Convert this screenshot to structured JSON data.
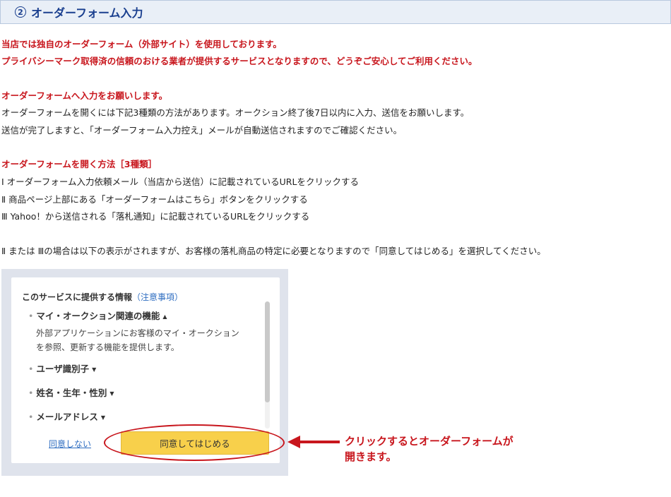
{
  "header": {
    "number": "2",
    "title": "オーダーフォーム入力"
  },
  "intro": {
    "line1": "当店では独自のオーダーフォーム（外部サイト）を使用しております。",
    "line2": "プライバシーマーク取得済の信頼のおける業者が提供するサービスとなりますので、どうぞご安心してご利用ください。"
  },
  "section1": {
    "heading": "オーダーフォームへ入力をお願いします。",
    "line1": "オーダーフォームを開くには下記3種類の方法があります。オークション終了後7日以内に入力、送信をお願いします。",
    "line2": "送信が完了しますと、「オーダーフォーム入力控え」メールが自動送信されますのでご確認ください。"
  },
  "section2": {
    "heading": "オーダーフォームを開く方法［3種類］",
    "methods": [
      "Ⅰ  オーダーフォーム入力依頼メール（当店から送信）に記載されているURLをクリックする",
      "Ⅱ  商品ページ上部にある「オーダーフォームはこちら」ボタンをクリックする",
      "Ⅲ  Yahoo！から送信される「落札通知」に記載されているURLをクリックする"
    ],
    "note": "Ⅱ または Ⅲの場合は以下の表示がされますが、お客様の落札商品の特定に必要となりますので「同意してはじめる」を選択してください。"
  },
  "consent": {
    "info_title": "このサービスに提供する情報",
    "info_link": "（注意事項）",
    "items": [
      {
        "label": "マイ・オークション関連の機能",
        "caret": "▲"
      },
      {
        "label": "ユーザ識別子",
        "caret": "▼"
      },
      {
        "label": "姓名・生年・性別",
        "caret": "▼"
      },
      {
        "label": "メールアドレス",
        "caret": "▼"
      }
    ],
    "desc_line1": "外部アプリケーションにお客様のマイ・オークション",
    "desc_line2": "を参照、更新する機能を提供します。",
    "decline_label": "同意しない",
    "agree_label": "同意してはじめる"
  },
  "callout": {
    "line1": "クリックするとオーダーフォームが",
    "line2": "開きます。"
  },
  "colors": {
    "accent_red": "#c8161d",
    "header_blue": "#1a3f8f",
    "button_yellow": "#f8d04b",
    "link_blue": "#2f6ec1"
  }
}
